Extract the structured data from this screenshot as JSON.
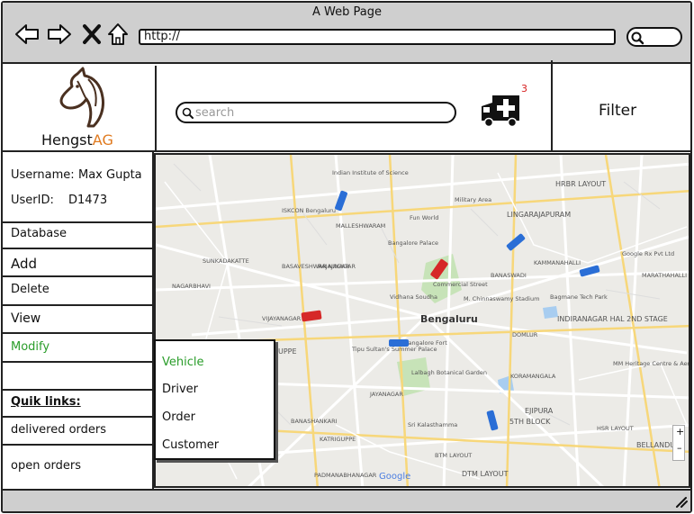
{
  "window": {
    "title": "A Web Page",
    "url": "http://"
  },
  "header": {
    "logo": {
      "brand_main": "Hengst",
      "brand_accent": "AG"
    },
    "search_placeholder": "search",
    "notification_count": "3",
    "filter_label": "Filter"
  },
  "sidebar": {
    "username_label": "Username:",
    "username_value": "Max Gupta",
    "userid_label": "UserID:",
    "userid_value": "D1473",
    "items": [
      {
        "label": "Database"
      },
      {
        "label": "Add"
      },
      {
        "label": "Delete"
      },
      {
        "label": "View"
      },
      {
        "label": "Modify"
      }
    ],
    "quick_links_label": "Quik links:",
    "links": [
      {
        "label": "delivered orders"
      },
      {
        "label": "open orders"
      }
    ]
  },
  "submenu": {
    "items": [
      {
        "label": "Vehicle",
        "active": true
      },
      {
        "label": "Driver",
        "active": false
      },
      {
        "label": "Order",
        "active": false
      },
      {
        "label": "Customer",
        "active": false
      }
    ]
  },
  "map": {
    "city_label": "Bengaluru",
    "labels": [
      "Indian Institute of Science",
      "ISKCON Bengaluru",
      "MALLESHWARAM",
      "Fun World",
      "Military Area",
      "LINGARAJAPURAM",
      "HRBR LAYOUT",
      "Bangalore Palace",
      "BASAVESHWAR NAGAR",
      "RAJAJINAGAR",
      "SUNKADAKATTE",
      "NAGARBHAVI",
      "VIJAYANAGAR",
      "Vidhana Soudha",
      "M. Chinnaswamy Stadium",
      "Commercial Street",
      "BANASWADI",
      "KAMMANAHALLI",
      "Bagmane Tech Park",
      "INDIRANAGAR HAL 2ND STAGE",
      "Bangalore Fort",
      "Tipu Sultan's Summer Palace",
      "Lalbagh Botanical Garden",
      "KORAMANGALA",
      "EJIPURA",
      "5TH BLOCK",
      "BELLANDUR",
      "HSR LAYOUT",
      "DTM LAYOUT",
      "JAYANAGAR",
      "BANASHANKARI",
      "KATRIGUPPE",
      "PADMANABHANAGAR",
      "Sri Kalasthamma",
      "MM Heritage Centre & Aerospace Museum",
      "Google Rx Pvt Ltd",
      "UPPE",
      "BTM LAYOUT",
      "DOMLUR",
      "MARATHAHALLI"
    ],
    "attribution": "Google"
  },
  "colors": {
    "accent": "#e07a1f",
    "active": "#2a9d2a",
    "badge": "#d62020",
    "vehicle_blue": "#2a6ed6",
    "vehicle_red": "#d62828"
  }
}
